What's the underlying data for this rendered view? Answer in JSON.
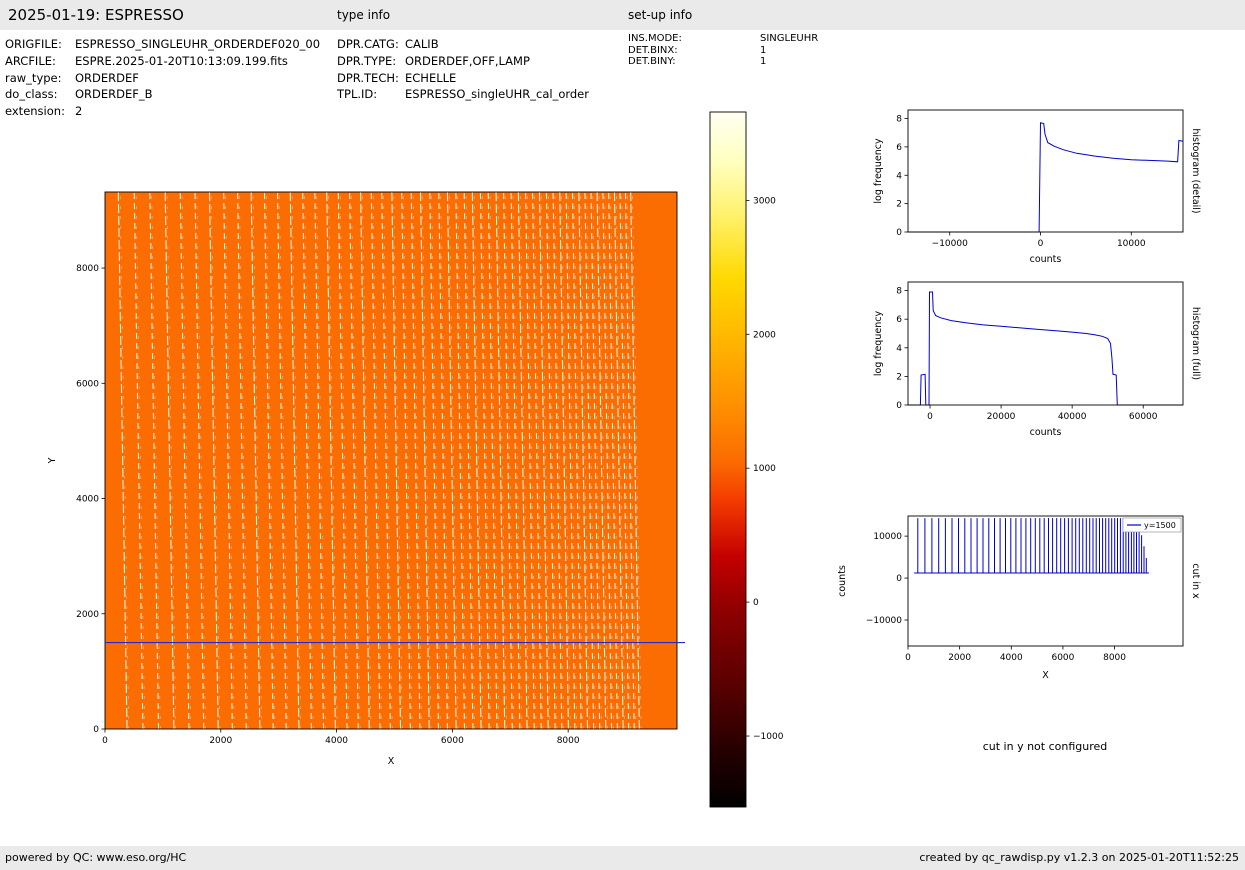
{
  "page": {
    "header": {
      "title": "2025-01-19: ESPRESSO",
      "type_info_label": "type info",
      "setup_info_label": "set-up info"
    },
    "metadata": {
      "left": [
        {
          "label": "ORIGFILE:",
          "value": "ESPRESSO_SINGLEUHR_ORDERDEF020_00"
        },
        {
          "label": "ARCFILE:",
          "value": "ESPRE.2025-01-20T10:13:09.199.fits"
        },
        {
          "label": "raw_type:",
          "value": "ORDERDEF"
        },
        {
          "label": "do_class:",
          "value": "ORDERDEF_B"
        },
        {
          "label": "extension:",
          "value": "2"
        }
      ],
      "middle": [
        {
          "label": "DPR.CATG:",
          "value": "CALIB"
        },
        {
          "label": "DPR.TYPE:",
          "value": "ORDERDEF,OFF,LAMP"
        },
        {
          "label": "DPR.TECH:",
          "value": "ECHELLE"
        },
        {
          "label": "TPL.ID:",
          "value": "ESPRESSO_singleUHR_cal_order"
        }
      ],
      "right": [
        {
          "label": "INS.MODE:",
          "value": "SINGLEUHR"
        },
        {
          "label": "DET.BINX:",
          "value": "1"
        },
        {
          "label": "DET.BINY:",
          "value": "1"
        }
      ]
    },
    "cut_y_note": "cut in y not configured",
    "footer": {
      "left": "powered by QC: www.eso.org/HC",
      "right": "created by qc_rawdisp.py v1.2.3 on 2025-01-20T11:52:25"
    }
  },
  "chart_data": [
    {
      "id": "raw_frame",
      "type": "heatmap",
      "title": "",
      "xlabel": "X",
      "ylabel": "Y",
      "xlim": [
        0,
        9880
      ],
      "ylim": [
        0,
        9320
      ],
      "xtick_vals": [
        0,
        2000,
        4000,
        6000,
        8000
      ],
      "xtick_labels": [
        "0",
        "2000",
        "4000",
        "6000",
        "8000"
      ],
      "ytick_vals": [
        0,
        2000,
        4000,
        6000,
        8000
      ],
      "ytick_labels": [
        "0",
        "2000",
        "4000",
        "6000",
        "8000"
      ],
      "background_value_color": "#fc6d01",
      "order_stripe_color": "#fffbee",
      "order_slant": -150,
      "order_positions": [
        380,
        655,
        925,
        1190,
        1450,
        1705,
        1955,
        2200,
        2440,
        2675,
        2905,
        3130,
        3350,
        3565,
        3775,
        3980,
        4180,
        4375,
        4565,
        4750,
        4930,
        5105,
        5275,
        5440,
        5600,
        5760,
        5915,
        6065,
        6210,
        6355,
        6495,
        6635,
        6770,
        6905,
        7035,
        7165,
        7290,
        7415,
        7535,
        7655,
        7775,
        7890,
        8005,
        8115,
        8225,
        8335,
        8440,
        8545,
        8650,
        8750,
        8850,
        8950,
        9045,
        9140,
        9230
      ],
      "cut_line": {
        "y": 1500,
        "color": "#2929cc"
      }
    },
    {
      "id": "colorbar",
      "type": "colorbar",
      "colormap": "hot",
      "vmin": -1530,
      "vmax": 3660,
      "tick_vals": [
        3000,
        2000,
        1000,
        0,
        -1000
      ],
      "tick_labels": [
        "3000",
        "2000",
        "1000",
        "0",
        "−1000"
      ],
      "stops": [
        {
          "at": 0.0,
          "color": "#020000"
        },
        {
          "at": 0.08,
          "color": "#250000"
        },
        {
          "at": 0.18,
          "color": "#5c0000"
        },
        {
          "at": 0.28,
          "color": "#8c0000"
        },
        {
          "at": 0.36,
          "color": "#c40000"
        },
        {
          "at": 0.44,
          "color": "#f43b00"
        },
        {
          "at": 0.5,
          "color": "#fc6d01"
        },
        {
          "at": 0.58,
          "color": "#ff9100"
        },
        {
          "at": 0.68,
          "color": "#ffb900"
        },
        {
          "at": 0.76,
          "color": "#ffd900"
        },
        {
          "at": 0.85,
          "color": "#fff16a"
        },
        {
          "at": 0.93,
          "color": "#ffffc0"
        },
        {
          "at": 1.0,
          "color": "#fffff2"
        }
      ]
    },
    {
      "id": "histogram_detail",
      "type": "line",
      "xlabel": "counts",
      "ylabel": "log frequency",
      "side_label": "histogram (detail)",
      "color": "#0000cc",
      "xlim": [
        -14600,
        15700
      ],
      "ylim": [
        0,
        8.6
      ],
      "xtick_vals": [
        -10000,
        0,
        10000
      ],
      "xtick_labels": [
        "−10000",
        "0",
        "10000"
      ],
      "ytick_vals": [
        0,
        2,
        4,
        6,
        8
      ],
      "ytick_labels": [
        "0",
        "2",
        "4",
        "6",
        "8"
      ],
      "points": [
        [
          -14600,
          0
        ],
        [
          -150,
          0
        ],
        [
          0,
          7.7
        ],
        [
          350,
          7.65
        ],
        [
          500,
          6.9
        ],
        [
          800,
          6.3
        ],
        [
          1500,
          6.05
        ],
        [
          2500,
          5.8
        ],
        [
          4000,
          5.55
        ],
        [
          6000,
          5.35
        ],
        [
          8000,
          5.2
        ],
        [
          10000,
          5.1
        ],
        [
          12000,
          5.05
        ],
        [
          14000,
          5.0
        ],
        [
          15100,
          4.95
        ],
        [
          15250,
          6.45
        ],
        [
          15700,
          6.4
        ]
      ]
    },
    {
      "id": "histogram_full",
      "type": "line",
      "xlabel": "counts",
      "ylabel": "log frequency",
      "side_label": "histogram (full)",
      "color": "#0000cc",
      "xlim": [
        -6200,
        71200
      ],
      "ylim": [
        0,
        8.6
      ],
      "xtick_vals": [
        0,
        20000,
        40000,
        60000
      ],
      "xtick_labels": [
        "0",
        "20000",
        "40000",
        "60000"
      ],
      "ytick_vals": [
        0,
        2,
        4,
        6,
        8
      ],
      "ytick_labels": [
        "0",
        "2",
        "4",
        "6",
        "8"
      ],
      "points": [
        [
          -6200,
          0
        ],
        [
          -2700,
          0
        ],
        [
          -2500,
          2.1
        ],
        [
          -1400,
          2.15
        ],
        [
          -1200,
          0
        ],
        [
          -300,
          0
        ],
        [
          -150,
          7.9
        ],
        [
          700,
          7.9
        ],
        [
          900,
          6.6
        ],
        [
          1600,
          6.25
        ],
        [
          3000,
          6.1
        ],
        [
          6000,
          5.9
        ],
        [
          10000,
          5.75
        ],
        [
          15000,
          5.6
        ],
        [
          20000,
          5.5
        ],
        [
          25000,
          5.4
        ],
        [
          30000,
          5.3
        ],
        [
          35000,
          5.2
        ],
        [
          40000,
          5.1
        ],
        [
          44000,
          5.0
        ],
        [
          46500,
          4.9
        ],
        [
          48500,
          4.8
        ],
        [
          50000,
          4.65
        ],
        [
          50800,
          4.3
        ],
        [
          51200,
          3.3
        ],
        [
          51500,
          2.15
        ],
        [
          52400,
          2.1
        ],
        [
          52700,
          0
        ],
        [
          71200,
          0
        ]
      ]
    },
    {
      "id": "cut_in_x",
      "type": "comb",
      "xlabel": "X",
      "ylabel": "counts",
      "side_label": "cut in x",
      "legend_label": "y=1500",
      "color": "#0000cc",
      "xlim": [
        0,
        10650
      ],
      "ylim": [
        -16200,
        14800
      ],
      "xtick_vals": [
        0,
        2000,
        4000,
        6000,
        8000
      ],
      "xtick_labels": [
        "0",
        "2000",
        "4000",
        "6000",
        "8000"
      ],
      "ytick_vals": [
        10000,
        0,
        -10000
      ],
      "ytick_labels": [
        "10000",
        "0",
        "−10000"
      ],
      "baseline": 1200,
      "x_start": 240,
      "x_end": 9330,
      "peak": 14300,
      "tail_heights": [
        13600,
        12300,
        10200,
        7600,
        4800
      ]
    }
  ]
}
